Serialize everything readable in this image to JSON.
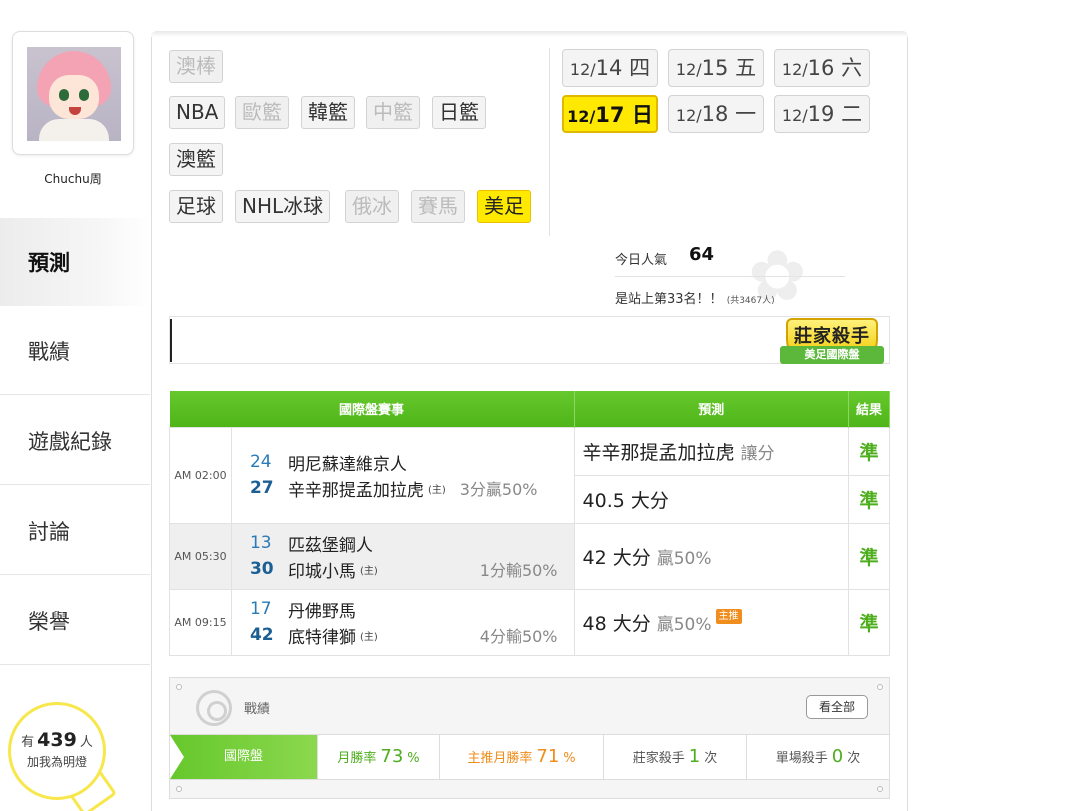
{
  "user": {
    "name": "Chuchu周"
  },
  "nav": [
    {
      "label": "預測",
      "active": true
    },
    {
      "label": "戰績"
    },
    {
      "label": "遊戲紀錄"
    },
    {
      "label": "討論"
    },
    {
      "label": "榮譽"
    }
  ],
  "follow": {
    "prefix": "有",
    "count": "439",
    "suffix": "人",
    "line2": "加我為明燈"
  },
  "categories": {
    "aus_baseball": "澳棒",
    "nba": "NBA",
    "euro_bball": "歐籃",
    "korea_bball": "韓籃",
    "china_bball": "中籃",
    "japan_bball": "日籃",
    "aus_bball": "澳籃",
    "soccer": "足球",
    "nhl": "NHL冰球",
    "russia_ice": "俄冰",
    "horse": "賽馬",
    "us_football": "美足"
  },
  "dates": [
    {
      "md": "12/",
      "day": "14",
      "wd": "四"
    },
    {
      "md": "12/",
      "day": "15",
      "wd": "五"
    },
    {
      "md": "12/",
      "day": "16",
      "wd": "六"
    },
    {
      "md": "12/",
      "day": "17",
      "wd": "日"
    },
    {
      "md": "12/",
      "day": "18",
      "wd": "一"
    },
    {
      "md": "12/",
      "day": "19",
      "wd": "二"
    }
  ],
  "popularity": {
    "label": "今日人氣",
    "value": "64"
  },
  "rank": {
    "text": "是站上第33名！！",
    "total": "(共3467人)"
  },
  "badge": {
    "title": "莊家殺手",
    "ribbon": "美足國際盤"
  },
  "table": {
    "headers": [
      "國際盤賽事",
      "預測",
      "結果"
    ],
    "games": [
      {
        "time": "AM 02:00",
        "away_score": "24",
        "away": "明尼蘇達維京人",
        "home_score": "27",
        "home": "辛辛那提孟加拉虎",
        "home_tag": "(主)",
        "note": "3分贏50%",
        "picks": [
          {
            "text": "辛辛那提孟加拉虎",
            "sub": "讓分",
            "result": "準"
          },
          {
            "text": "40.5 大分",
            "sub": "",
            "result": "準"
          }
        ]
      },
      {
        "time": "AM 05:30",
        "away_score": "13",
        "away": "匹茲堡鋼人",
        "home_score": "30",
        "home": "印城小馬",
        "home_tag": "(主)",
        "note": "1分輸50%",
        "picks": [
          {
            "text": "42 大分",
            "sub": "贏50%",
            "result": "準"
          }
        ]
      },
      {
        "time": "AM 09:15",
        "away_score": "17",
        "away": "丹佛野馬",
        "home_score": "42",
        "home": "底特律獅",
        "home_tag": "(主)",
        "note": "4分輸50%",
        "picks": [
          {
            "text": "48 大分",
            "sub": "贏50%",
            "tag": "主推",
            "result": "準"
          }
        ]
      }
    ]
  },
  "stats": {
    "title": "戰績",
    "view_all": "看全部",
    "segment": "國際盤",
    "monthly_label": "月勝率",
    "monthly_value": "73",
    "monthly_unit": "%",
    "main_label": "主推月勝率",
    "main_value": "71",
    "main_unit": "%",
    "killer_label": "莊家殺手",
    "killer_value": "1",
    "killer_unit": "次",
    "single_label": "單場殺手",
    "single_value": "0",
    "single_unit": "次"
  },
  "colors": {
    "accent_green": "#4eb519",
    "highlight_yellow": "#ffe900",
    "orange": "#f08d1c",
    "score_blue": "#2a7bb5"
  }
}
